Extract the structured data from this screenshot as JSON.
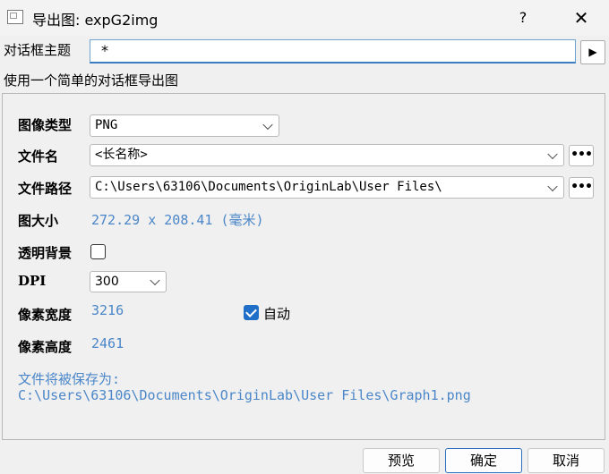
{
  "window": {
    "title": "导出图: expG2img",
    "help_label": "?",
    "close_label": "✕"
  },
  "subject": {
    "label": "对话框主题",
    "value": "*",
    "play_label": "▶"
  },
  "description": "使用一个简单的对话框导出图",
  "form": {
    "image_type": {
      "label": "图像类型",
      "value": "PNG"
    },
    "file_name": {
      "label": "文件名",
      "value": "<长名称>",
      "browse_label": "•••"
    },
    "file_path": {
      "label": "文件路径",
      "value": "C:\\Users\\63106\\Documents\\OriginLab\\User Files\\",
      "browse_label": "•••"
    },
    "image_size": {
      "label": "图大小",
      "value": "272.29 x 208.41 (毫米)"
    },
    "transparent_bg": {
      "label": "透明背景",
      "checked": false
    },
    "dpi": {
      "label": "DPI",
      "value": "300"
    },
    "pixel_width": {
      "label": "像素宽度",
      "value": "3216"
    },
    "auto": {
      "label": "自动",
      "checked": true
    },
    "pixel_height": {
      "label": "像素高度",
      "value": "2461"
    },
    "save_as": {
      "label": "文件将被保存为:",
      "path": "C:\\Users\\63106\\Documents\\OriginLab\\User Files\\Graph1.png"
    }
  },
  "buttons": {
    "preview": "预览",
    "ok": "确定",
    "cancel": "取消"
  },
  "colors": {
    "accent": "#1f6fc8",
    "info_text": "#4a86c8"
  }
}
